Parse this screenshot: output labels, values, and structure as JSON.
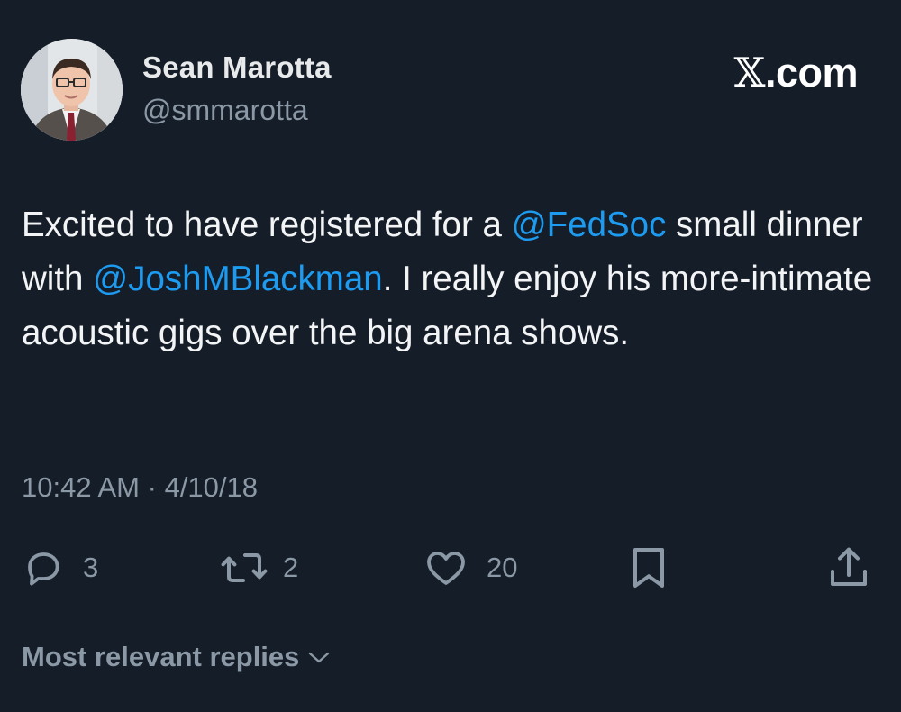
{
  "author": {
    "display_name": "Sean Marotta",
    "handle": "@smmarotta"
  },
  "brand": {
    "mark": "𝕏",
    "suffix": ".com"
  },
  "tweet": {
    "parts": [
      {
        "text": "Excited to have registered for a ",
        "type": "text"
      },
      {
        "text": "@FedSoc",
        "type": "mention"
      },
      {
        "text": " small dinner with ",
        "type": "text"
      },
      {
        "text": "@JoshMBlackman",
        "type": "mention"
      },
      {
        "text": ".  I really enjoy his more-intimate acoustic gigs over the big arena shows.",
        "type": "text"
      }
    ]
  },
  "meta": {
    "time": "10:42 AM",
    "separator": "·",
    "date": "4/10/18"
  },
  "actions": {
    "reply_count": "3",
    "retweet_count": "2",
    "like_count": "20"
  },
  "footer": {
    "replies_sort_label": "Most relevant replies"
  },
  "icons": {
    "reply": "reply-icon",
    "retweet": "retweet-icon",
    "like": "heart-icon",
    "bookmark": "bookmark-icon",
    "share": "share-icon",
    "chevron": "chevron-down-icon"
  },
  "colors": {
    "background": "#151d28",
    "mention": "#1d9bf0",
    "muted": "#8b98a5",
    "text": "#e7e9ea"
  }
}
